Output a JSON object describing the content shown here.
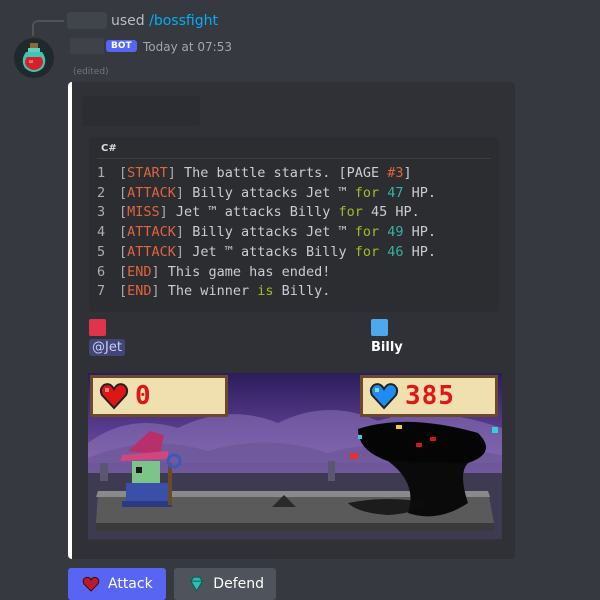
{
  "reply": {
    "used": "used",
    "command": "/bossfight"
  },
  "message": {
    "bot_tag": "BOT",
    "timestamp": "Today at 07:53",
    "edited": "(edited)"
  },
  "embed": {
    "code_language": "C#",
    "code_lines": [
      {
        "num": "1",
        "parts": [
          [
            "br",
            "["
          ],
          [
            "tag",
            "START"
          ],
          [
            "br",
            "]"
          ],
          [
            "txt",
            " The battle starts. [PAGE "
          ],
          [
            "tag",
            "#3"
          ],
          [
            "txt",
            "]"
          ]
        ]
      },
      {
        "num": "2",
        "parts": [
          [
            "br",
            "["
          ],
          [
            "tag",
            "ATTACK"
          ],
          [
            "br",
            "]"
          ],
          [
            "txt",
            " Billy attacks Jet ™ "
          ],
          [
            "kw",
            "for"
          ],
          [
            "txt",
            " "
          ],
          [
            "num",
            "47"
          ],
          [
            "txt",
            " HP."
          ]
        ]
      },
      {
        "num": "3",
        "parts": [
          [
            "br",
            "["
          ],
          [
            "tag",
            "MISS"
          ],
          [
            "br",
            "]"
          ],
          [
            "txt",
            " Jet ™ attacks Billy "
          ],
          [
            "kw",
            "for"
          ],
          [
            "txt",
            " 45 HP."
          ]
        ]
      },
      {
        "num": "4",
        "parts": [
          [
            "br",
            "["
          ],
          [
            "tag",
            "ATTACK"
          ],
          [
            "br",
            "]"
          ],
          [
            "txt",
            " Billy attacks Jet ™ "
          ],
          [
            "kw",
            "for"
          ],
          [
            "txt",
            " "
          ],
          [
            "num",
            "49"
          ],
          [
            "txt",
            " HP."
          ]
        ]
      },
      {
        "num": "5",
        "parts": [
          [
            "br",
            "["
          ],
          [
            "tag",
            "ATTACK"
          ],
          [
            "br",
            "]"
          ],
          [
            "txt",
            " Jet ™ attacks Billy "
          ],
          [
            "kw",
            "for"
          ],
          [
            "txt",
            " "
          ],
          [
            "num",
            "46"
          ],
          [
            "txt",
            " HP."
          ]
        ]
      },
      {
        "num": "6",
        "parts": [
          [
            "br",
            "["
          ],
          [
            "tag",
            "END"
          ],
          [
            "br",
            "]"
          ],
          [
            "txt",
            " This game has ended!"
          ]
        ]
      },
      {
        "num": "7",
        "parts": [
          [
            "br",
            "["
          ],
          [
            "tag",
            "END"
          ],
          [
            "br",
            "]"
          ],
          [
            "txt",
            " The winner "
          ],
          [
            "kw",
            "is"
          ],
          [
            "txt",
            " Billy."
          ]
        ]
      }
    ],
    "players": [
      {
        "name": "@Jet",
        "color": "#e0334c"
      },
      {
        "name": "Billy",
        "color": "#4fa8ee"
      }
    ],
    "battle": {
      "left_hp": "0",
      "right_hp": "385"
    }
  },
  "buttons": [
    {
      "label": "Attack",
      "icon": "heart-icon",
      "color": "#5865f2"
    },
    {
      "label": "Defend",
      "icon": "gem-icon",
      "color": "#4f545c"
    }
  ]
}
